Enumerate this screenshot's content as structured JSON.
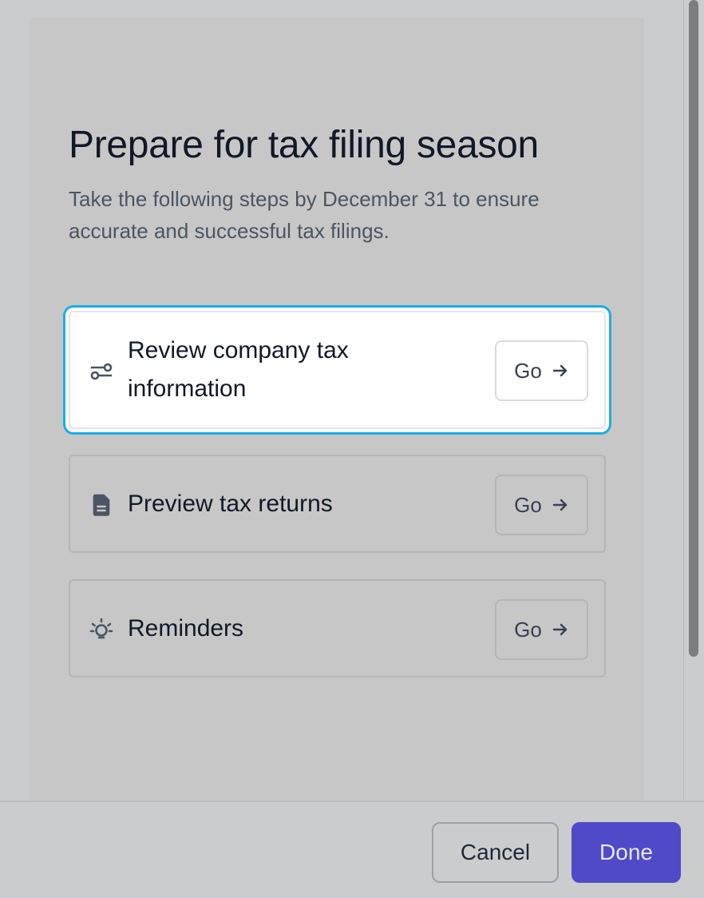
{
  "dialog": {
    "title": "Prepare for tax filing season",
    "subtitle": "Take the following steps by December 31 to ensure accurate and successful tax filings.",
    "steps": [
      {
        "label": "Review company tax information",
        "icon": "sliders-icon",
        "action": "Go",
        "active": true
      },
      {
        "label": "Preview tax returns",
        "icon": "document-icon",
        "action": "Go",
        "active": false
      },
      {
        "label": "Reminders",
        "icon": "lightbulb-icon",
        "action": "Go",
        "active": false
      }
    ]
  },
  "footer": {
    "cancel_label": "Cancel",
    "done_label": "Done"
  },
  "colors": {
    "focus_ring": "#1aaee5",
    "primary": "#4f4ac7"
  }
}
